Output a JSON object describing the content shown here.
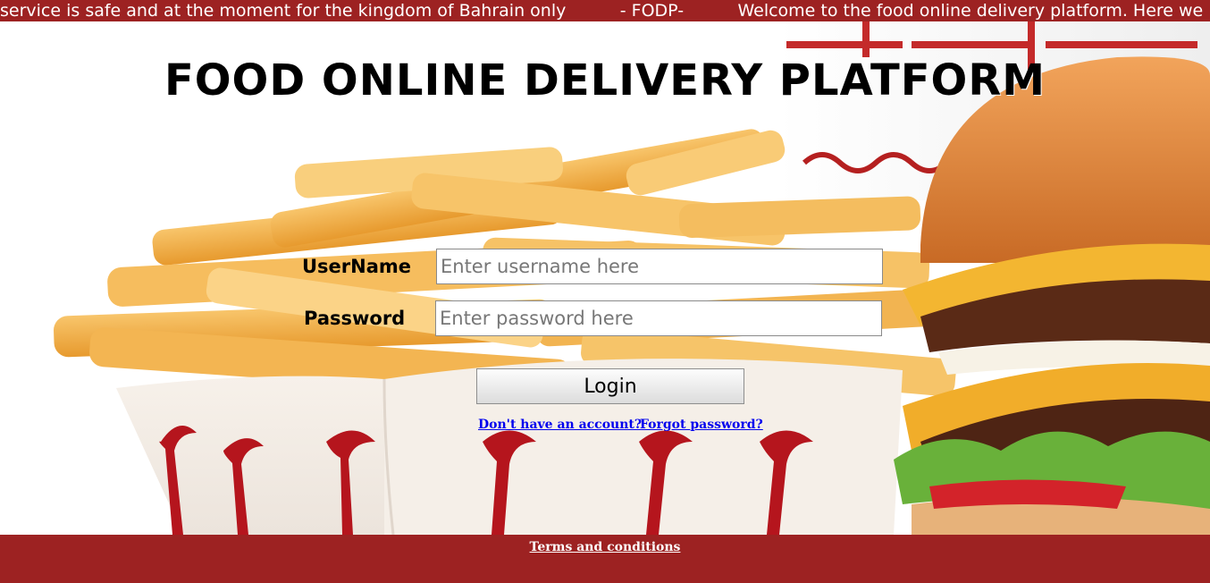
{
  "marquee": {
    "text": "service is safe and at the moment for the kingdom of Bahrain only          - FODP-          Welcome to the food online delivery platform. Here we"
  },
  "hero": {
    "image": "fries-and-burger-photo"
  },
  "header": {
    "title": "FOOD ONLINE DELIVERY PLATFORM"
  },
  "login_form": {
    "username_label": "UserName",
    "username_placeholder": "Enter username here",
    "password_label": "Password",
    "password_placeholder": "Enter password here",
    "login_button": "Login",
    "signup_link": "Don't have an account?",
    "forgot_link": "Forgot password?"
  },
  "footer": {
    "terms_link": "Terms and conditions"
  },
  "colors": {
    "brand_red": "#9d2222",
    "link_blue": "#0000ee"
  }
}
